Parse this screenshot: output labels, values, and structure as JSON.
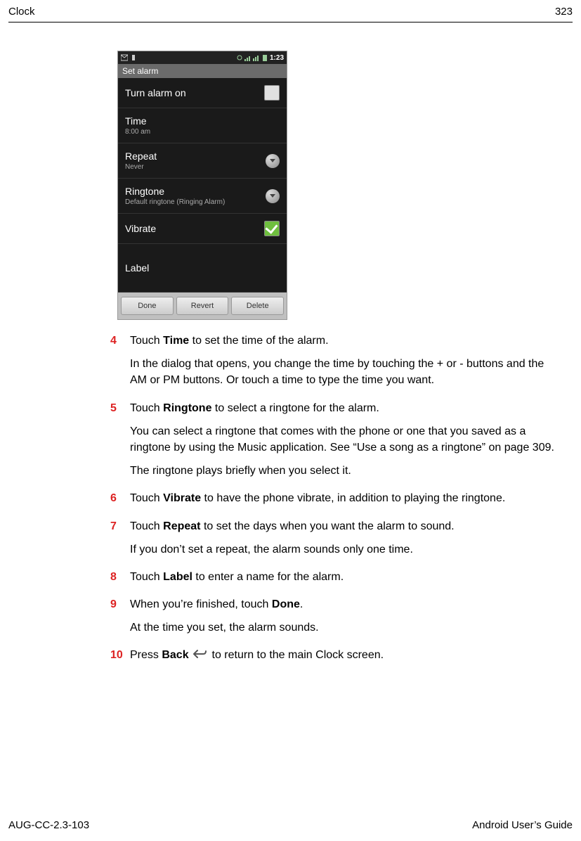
{
  "header": {
    "left": "Clock",
    "right": "323"
  },
  "phone": {
    "time": "1:23",
    "title": "Set alarm",
    "rows": {
      "turn_on": "Turn alarm on",
      "time_label": "Time",
      "time_value": "8:00 am",
      "repeat_label": "Repeat",
      "repeat_value": "Never",
      "ringtone_label": "Ringtone",
      "ringtone_value": "Default ringtone (Ringing Alarm)",
      "vibrate": "Vibrate",
      "label": "Label"
    },
    "buttons": {
      "done": "Done",
      "revert": "Revert",
      "delete": "Delete"
    }
  },
  "steps": {
    "s4": {
      "num": "4",
      "line1a": "Touch ",
      "line1b": "Time",
      "line1c": " to set the time of the alarm.",
      "p2": "In the dialog that opens, you change the time by touching the + or - buttons and the AM or PM buttons. Or touch a time to type the time you want."
    },
    "s5": {
      "num": "5",
      "line1a": "Touch ",
      "line1b": "Ringtone",
      "line1c": " to select a ringtone for the alarm.",
      "p2": "You can select a ringtone that comes with the phone or one that you saved as a ringtone by using the Music application. See “Use a song as a ringtone” on page 309.",
      "p3": "The ringtone plays briefly when you select it."
    },
    "s6": {
      "num": "6",
      "line1a": "Touch ",
      "line1b": "Vibrate",
      "line1c": " to have the phone vibrate, in addition to playing the ringtone."
    },
    "s7": {
      "num": "7",
      "line1a": "Touch ",
      "line1b": "Repeat",
      "line1c": " to set the days when you want the alarm to sound.",
      "p2": "If you don’t set a repeat, the alarm sounds only one time."
    },
    "s8": {
      "num": "8",
      "line1a": "Touch ",
      "line1b": "Label",
      "line1c": " to enter a name for the alarm."
    },
    "s9": {
      "num": "9",
      "line1a": "When you’re finished, touch ",
      "line1b": "Done",
      "line1c": ".",
      "p2": "At the time you set, the alarm sounds."
    },
    "s10": {
      "num": "10",
      "line1a": "Press ",
      "line1b": "Back",
      "line1c": " to return to the main Clock screen."
    }
  },
  "footer": {
    "left": "AUG-CC-2.3-103",
    "right": "Android User’s Guide"
  }
}
